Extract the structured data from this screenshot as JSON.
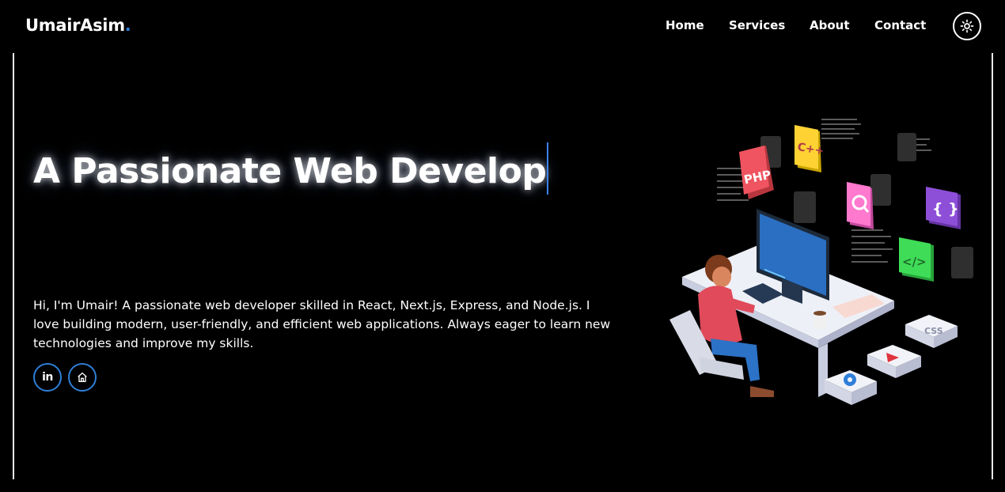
{
  "brand": {
    "name": "UmairAsim",
    "dot": ".",
    "dot_color": "#2f7fd8"
  },
  "nav": {
    "items": [
      {
        "label": "Home"
      },
      {
        "label": "Services"
      },
      {
        "label": "About"
      },
      {
        "label": "Contact"
      }
    ],
    "theme_toggle_icon": "sun-icon"
  },
  "hero": {
    "title": "A Passionate Web Develop",
    "intro": "Hi, I'm Umair! A passionate web developer skilled in React, Next.js, Express, and Node.js. I love building modern, user-friendly, and efficient web applications. Always eager to learn new technologies and improve my skills.",
    "socials": [
      {
        "name": "linkedin",
        "icon": "linkedin-icon",
        "text": "in"
      },
      {
        "name": "home",
        "icon": "home-icon"
      }
    ]
  },
  "illustration": {
    "subject": "developer at computer desk isometric",
    "badges": [
      "PHP",
      "C++",
      "</>",
      "{ }",
      "CSS"
    ]
  },
  "colors": {
    "accent": "#2f7fd8",
    "background": "#000000",
    "caret": "#3b82f6"
  }
}
